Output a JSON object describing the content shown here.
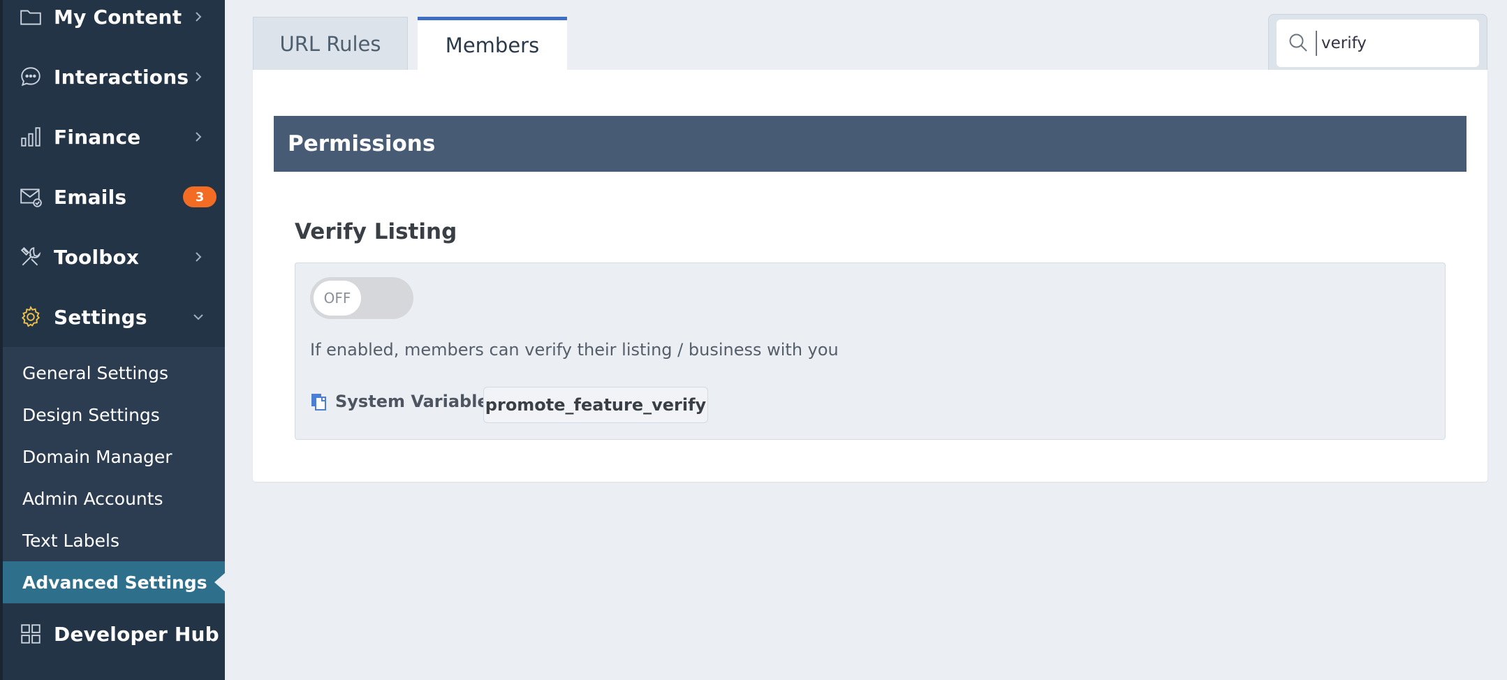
{
  "sidebar": {
    "items": [
      {
        "label": "My Content",
        "icon": "folder-icon"
      },
      {
        "label": "Interactions",
        "icon": "chat-icon"
      },
      {
        "label": "Finance",
        "icon": "bar-chart-icon"
      },
      {
        "label": "Emails",
        "icon": "email-icon",
        "badge": "3"
      },
      {
        "label": "Toolbox",
        "icon": "tools-icon"
      },
      {
        "label": "Settings",
        "icon": "gear-icon"
      }
    ],
    "submenu": [
      {
        "label": "General Settings"
      },
      {
        "label": "Design Settings"
      },
      {
        "label": "Domain Manager"
      },
      {
        "label": "Admin Accounts"
      },
      {
        "label": "Text Labels"
      },
      {
        "label": "Advanced Settings",
        "active": true
      }
    ],
    "developer_hub": {
      "label": "Developer Hub",
      "icon": "grid-icon"
    }
  },
  "tabs": [
    {
      "label": "URL Rules",
      "active": false
    },
    {
      "label": "Members",
      "active": true
    }
  ],
  "search": {
    "value": "verify",
    "icon": "search-icon"
  },
  "section_header": "Permissions",
  "setting": {
    "title": "Verify Listing",
    "toggle_state": "OFF",
    "help_text": "If enabled, members can verify their listing / business with you",
    "system_variable_label": "System Variable",
    "system_variable_value": "promote_feature_verify"
  },
  "colors": {
    "sidebar_bg": "#243447",
    "submenu_bg": "#2c3d52",
    "active_sub_bg": "#2e6f8c",
    "badge": "#f26c24",
    "tab_accent": "#3d6ec4",
    "section_header_bg": "#475b75"
  }
}
